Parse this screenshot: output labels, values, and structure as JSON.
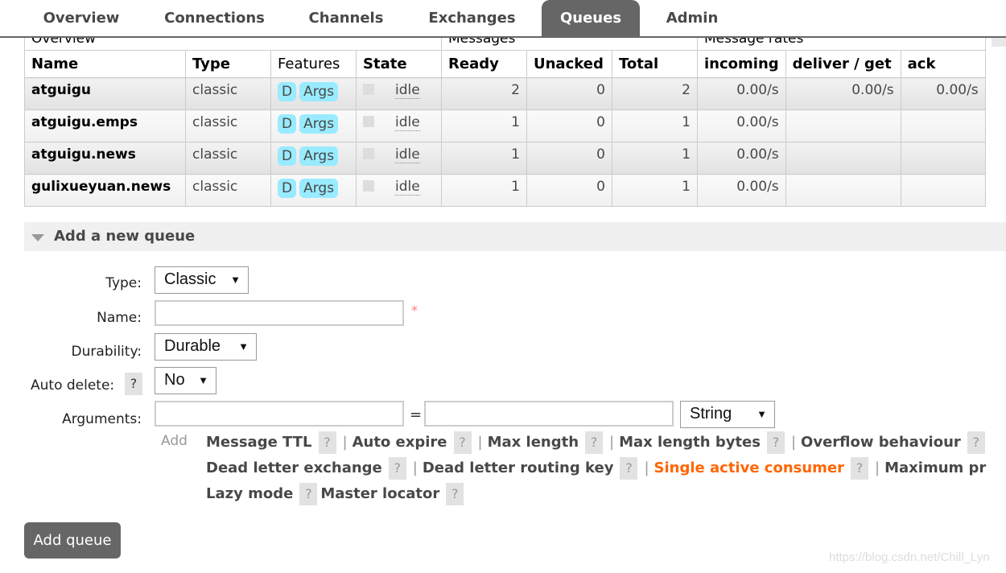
{
  "nav": {
    "tabs": [
      {
        "label": "Overview",
        "active": false
      },
      {
        "label": "Connections",
        "active": false
      },
      {
        "label": "Channels",
        "active": false
      },
      {
        "label": "Exchanges",
        "active": false
      },
      {
        "label": "Queues",
        "active": true
      },
      {
        "label": "Admin",
        "active": false
      }
    ]
  },
  "table": {
    "groups": [
      "Overview",
      "Messages",
      "Message rates"
    ],
    "columns": [
      "Name",
      "Type",
      "Features",
      "State",
      "Ready",
      "Unacked",
      "Total",
      "incoming",
      "deliver / get",
      "ack"
    ],
    "rows": [
      {
        "name": "atguigu",
        "type": "classic",
        "features": [
          "D",
          "Args"
        ],
        "state": "idle",
        "ready": "2",
        "unacked": "0",
        "total": "2",
        "incoming": "0.00/s",
        "deliver": "0.00/s",
        "ack": "0.00/s"
      },
      {
        "name": "atguigu.emps",
        "type": "classic",
        "features": [
          "D",
          "Args"
        ],
        "state": "idle",
        "ready": "1",
        "unacked": "0",
        "total": "1",
        "incoming": "0.00/s",
        "deliver": "",
        "ack": ""
      },
      {
        "name": "atguigu.news",
        "type": "classic",
        "features": [
          "D",
          "Args"
        ],
        "state": "idle",
        "ready": "1",
        "unacked": "0",
        "total": "1",
        "incoming": "0.00/s",
        "deliver": "",
        "ack": ""
      },
      {
        "name": "gulixueyuan.news",
        "type": "classic",
        "features": [
          "D",
          "Args"
        ],
        "state": "idle",
        "ready": "1",
        "unacked": "0",
        "total": "1",
        "incoming": "0.00/s",
        "deliver": "",
        "ack": ""
      }
    ]
  },
  "form": {
    "section_title": "Add a new queue",
    "type_label": "Type:",
    "type_value": "Classic",
    "name_label": "Name:",
    "name_value": "",
    "required_mark": "*",
    "durability_label": "Durability:",
    "durability_value": "Durable",
    "auto_delete_label": "Auto delete:",
    "auto_delete_value": "No",
    "arguments_label": "Arguments:",
    "arg_key": "",
    "arg_value": "",
    "equals": "=",
    "arg_type": "String",
    "add_label": "Add",
    "help_rows": [
      [
        {
          "label": "Message TTL"
        },
        {
          "label": "Auto expire"
        },
        {
          "label": "Max length"
        },
        {
          "label": "Max length bytes"
        },
        {
          "label": "Overflow behaviour"
        }
      ],
      [
        {
          "label": "Dead letter exchange"
        },
        {
          "label": "Dead letter routing key"
        },
        {
          "label": "Single active consumer",
          "highlight": true
        },
        {
          "label": "Maximum pr"
        }
      ],
      [
        {
          "label": "Lazy mode"
        },
        {
          "label": "Master locator"
        }
      ]
    ],
    "help_glyph": "?",
    "submit": "Add queue"
  },
  "watermark": "https://blog.csdn.net/Chill_Lyn",
  "colors": {
    "active_tab": "#666666",
    "badge": "#99ebff",
    "highlight_link": "#ff6600"
  }
}
